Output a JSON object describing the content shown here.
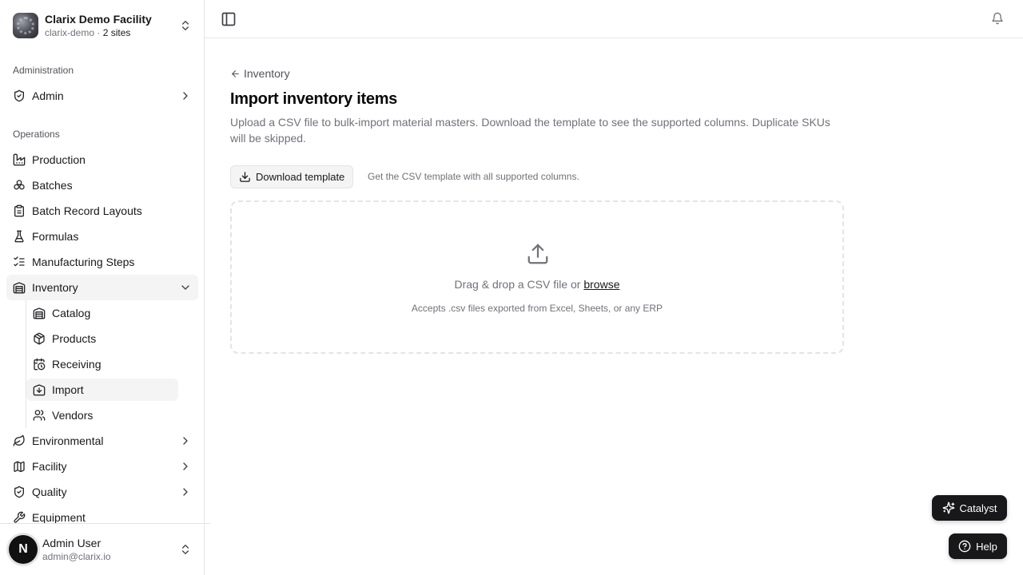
{
  "org": {
    "name": "Clarix Demo Facility",
    "slug": "clarix-demo",
    "sep": " · ",
    "sites": "2 sites"
  },
  "sidebar": {
    "admin_section": "Administration",
    "admin_items": [
      {
        "label": "Admin",
        "icon": "shield-check-icon"
      }
    ],
    "ops_section": "Operations",
    "ops_items": [
      {
        "label": "Production",
        "icon": "factory-icon"
      },
      {
        "label": "Batches",
        "icon": "boxes-icon"
      },
      {
        "label": "Batch Record Layouts",
        "icon": "clipboard-icon"
      },
      {
        "label": "Formulas",
        "icon": "flask-icon"
      },
      {
        "label": "Manufacturing Steps",
        "icon": "list-checks-icon"
      },
      {
        "label": "Inventory",
        "icon": "warehouse-icon"
      }
    ],
    "inventory_sub": [
      {
        "label": "Catalog",
        "icon": "warehouse-icon"
      },
      {
        "label": "Products",
        "icon": "package-icon"
      },
      {
        "label": "Receiving",
        "icon": "calendar-clock-icon"
      },
      {
        "label": "Import",
        "icon": "import-icon"
      },
      {
        "label": "Vendors",
        "icon": "users-icon"
      }
    ],
    "more_items": [
      {
        "label": "Environmental",
        "icon": "leaf-icon"
      },
      {
        "label": "Facility",
        "icon": "map-icon"
      },
      {
        "label": "Quality",
        "icon": "shield-check-icon"
      },
      {
        "label": "Equipment",
        "icon": "wrench-icon"
      }
    ]
  },
  "user": {
    "initial": "N",
    "name": "Admin User",
    "email": "admin@clarix.io"
  },
  "main": {
    "back_label": "Inventory",
    "title": "Import inventory items",
    "description": "Upload a CSV file to bulk-import material masters. Download the template to see the supported columns. Duplicate SKUs will be skipped.",
    "download_label": "Download template",
    "download_hint": "Get the CSV template with all supported columns.",
    "drop_text": "Drag & drop a CSV file or ",
    "browse_label": "browse",
    "drop_subtext": "Accepts .csv files exported from Excel, Sheets, or any ERP"
  },
  "floating": {
    "catalyst_label": "Catalyst",
    "help_label": "Help"
  }
}
